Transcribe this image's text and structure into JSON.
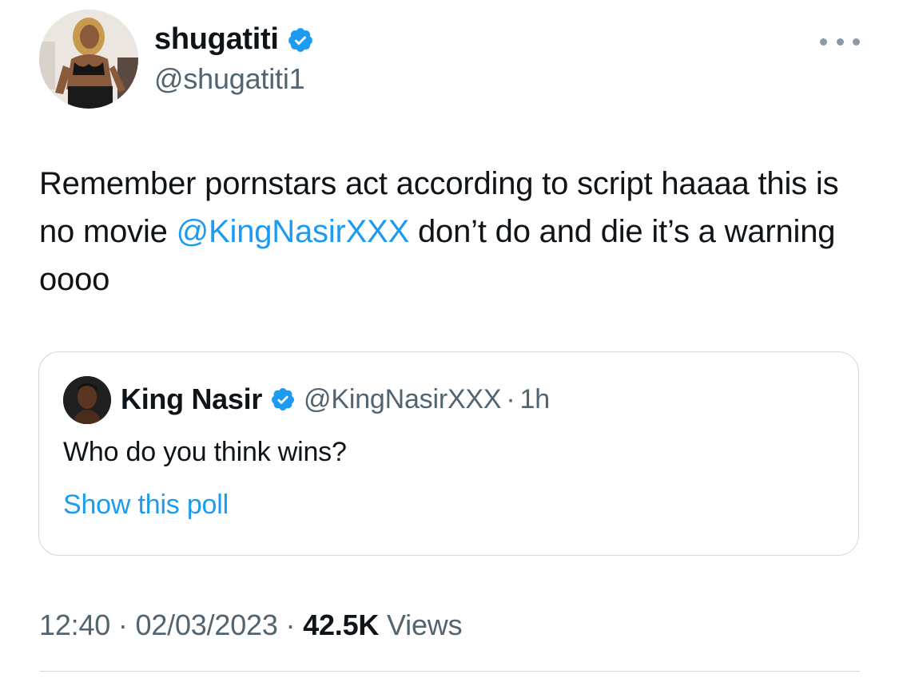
{
  "author": {
    "name": "shugatiti",
    "handle": "@shugatiti1",
    "verified": true
  },
  "tweet": {
    "text_before": "Remember pornstars act according to script haaaa this is no movie ",
    "mention": "@KingNasirXXX",
    "text_after": " don’t do and die it’s a warning oooo"
  },
  "quoted_tweet": {
    "name": "King Nasir",
    "handle": "@KingNasirXXX",
    "separator": "·",
    "time": "1h",
    "text": "Who do you think wins?",
    "poll_link": "Show this poll"
  },
  "meta": {
    "time": "12:40",
    "sep1": "·",
    "date": "02/03/2023",
    "sep2": "·",
    "views_count": "42.5K",
    "views_label": "Views"
  },
  "icons": {
    "verified": "verified-badge-icon",
    "more": "more-options-icon"
  },
  "colors": {
    "accent": "#1d9bf0",
    "text": "#0f1419",
    "secondary_text": "#536471",
    "border": "#cfd9de"
  }
}
